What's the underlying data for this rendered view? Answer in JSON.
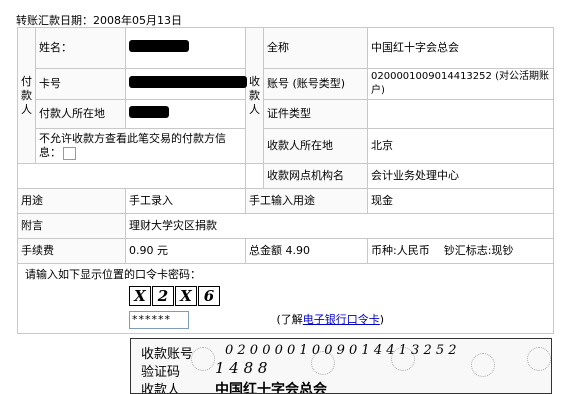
{
  "header": {
    "date_label": "转账汇款日期：2008年05月13日"
  },
  "payer": {
    "section_label": "付款人",
    "name_label": "姓名：",
    "card_label": "卡号",
    "location_label": "付款人所在地",
    "privacy_label": "不允许收款方查看此笔交易的付款方信息："
  },
  "payee": {
    "section_label": "收款人",
    "fullname_label": "全称",
    "fullname_value": "中国红十字会总会",
    "account_label": "账号 (账号类型)",
    "account_value": "0200001009014413252 (对公活期账户)",
    "id_type_label": "证件类型",
    "id_type_value": "",
    "location_label": "收款人所在地",
    "location_value": "北京",
    "branch_label": "收款网点机构名",
    "branch_value": "会计业务处理中心"
  },
  "usage": {
    "label": "用途",
    "value": "手工录入",
    "manual_label": "手工输入用途",
    "manual_value": "现金"
  },
  "note": {
    "label": "附言",
    "value": "理财大学灾区捐款"
  },
  "fees": {
    "fee_label": "手续费",
    "fee_value": "0.90 元",
    "total_label": "总金额",
    "total_value": "4.90",
    "currency_text": "币种:人民币",
    "cash_flag_text": "钞汇标志:现钞"
  },
  "password": {
    "prompt": "请输入如下显示位置的口令卡密码：",
    "grid_chars": [
      "X",
      "2",
      "X",
      "6"
    ],
    "input_value": "******",
    "link_prefix": "(了解",
    "link_text": "电子银行口令卡",
    "link_suffix": ")"
  },
  "card_preview": {
    "account_label": "收款账号",
    "account_digits": "0 2  0 0 0 0 1 0 0 9 0  1 4 4 1  3 2 5 2",
    "code_label": "验证码",
    "code_value": "1 4 8 8",
    "payee_label": "收款人",
    "payee_value": "中国红十字会总会"
  }
}
